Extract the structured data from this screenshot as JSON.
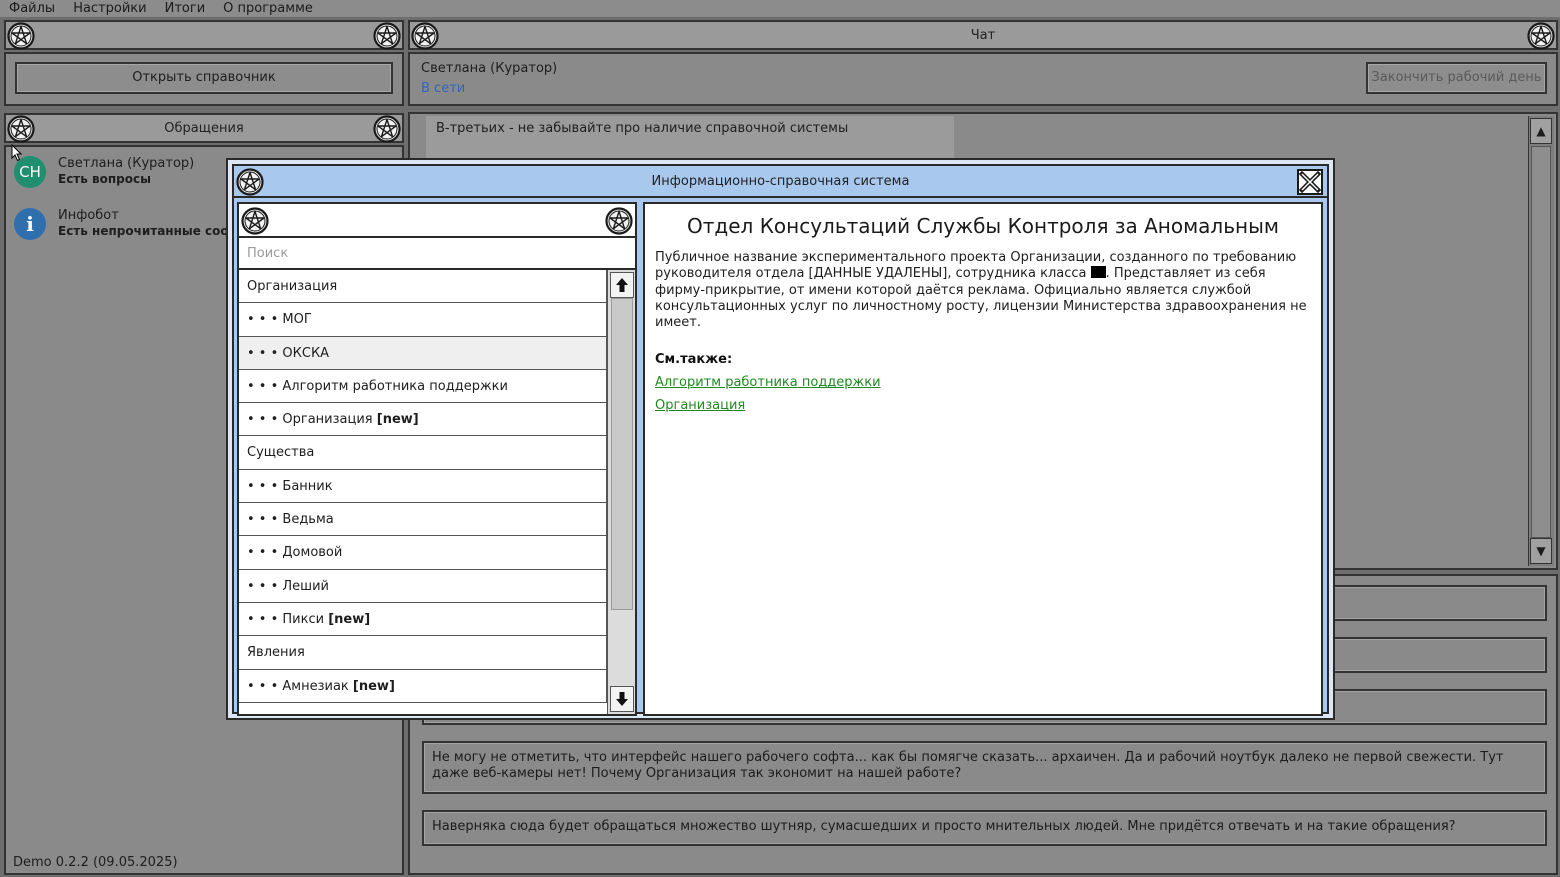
{
  "menu": [
    "Файлы",
    "Настройки",
    "Итоги",
    "О программе"
  ],
  "left_panel": {
    "open_reference_button": "Открыть справочник",
    "tickets_title": "Обращения",
    "tickets": [
      {
        "initials": "СН",
        "name": "Светлана (Куратор)",
        "status": "Есть вопросы",
        "color": "#1f8f6f"
      },
      {
        "initials": "i",
        "name": "Инфобот",
        "status": "Есть непрочитанные сообщения",
        "color": "#2f6fae"
      }
    ],
    "version": "Demo 0.2.2 (09.05.2025)"
  },
  "chat": {
    "title": "Чат",
    "contact_name": "Светлана (Куратор)",
    "contact_status": "В сети",
    "end_day_button": "Закончить рабочий день",
    "top_message": "В-третьих - не забывайте про наличие справочной системы",
    "reply_options": [
      "Не могу не отметить, что интерфейс нашего рабочего софта... как бы помягче сказать... архаичен. Да и рабочий ноутбук далеко не первой свежести. Тут даже веб-камеры нет! Почему Организация так экономит на нашей работе?",
      "Наверняка сюда будет обращаться множество шутняр, сумасшедших и просто мнительных людей. Мне придётся отвечать и на такие обращения?"
    ]
  },
  "reference": {
    "title": "Информационно-справочная система",
    "search_placeholder": "Поиск",
    "items": [
      {
        "label": "Организация",
        "tag": "",
        "indent": false
      },
      {
        "label": "• • • МОГ",
        "tag": "",
        "indent": true
      },
      {
        "label": "• • • ОКСКА",
        "tag": "",
        "indent": true,
        "selected": true
      },
      {
        "label": "• • • Алгоритм работника поддержки",
        "tag": "",
        "indent": true
      },
      {
        "label": "• • • Организация ",
        "tag": "[new]",
        "indent": true
      },
      {
        "label": "Существа",
        "tag": "",
        "indent": false
      },
      {
        "label": "• • • Банник",
        "tag": "",
        "indent": true
      },
      {
        "label": "• • • Ведьма",
        "tag": "",
        "indent": true
      },
      {
        "label": "• • • Домовой",
        "tag": "",
        "indent": true
      },
      {
        "label": "• • • Леший",
        "tag": "",
        "indent": true
      },
      {
        "label": "• • • Пикси ",
        "tag": "[new]",
        "indent": true
      },
      {
        "label": "Явления",
        "tag": "",
        "indent": false
      },
      {
        "label": "• • • Амнезиак ",
        "tag": "[new]",
        "indent": true
      }
    ],
    "article": {
      "title": "Отдел Консультаций Службы Контроля за Аномальным",
      "body_part1": "Публичное название экспериментального проекта Организации, созданного по требованию руководителя отдела [ДАННЫЕ УДАЛЕНЫ], сотрудника класса ",
      "body_part2": ". Представляет из себя фирму-прикрытие, от имени которой даётся реклама. Официально является службой консультационных услуг по личностному росту, лицензии Министерства здравоохранения не имеет.",
      "see_also_label": "См.также:",
      "see_also": [
        "Алгоритм работника поддержки",
        "Организация"
      ]
    }
  },
  "icons": {
    "emblem": "pentagram-icon",
    "close": "close-icon",
    "scroll_up": "arrow-up-icon",
    "scroll_down": "arrow-down-icon"
  }
}
